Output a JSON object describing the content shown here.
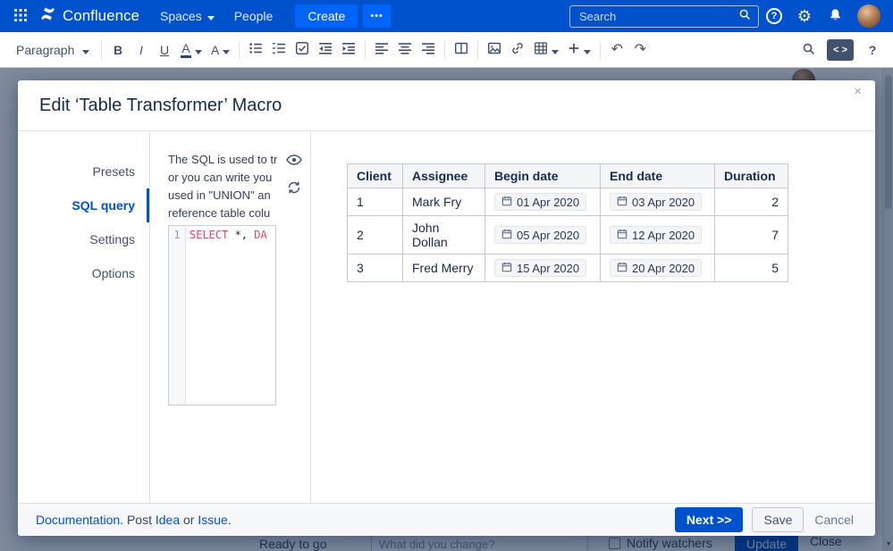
{
  "colors": {
    "nav_background": "#0052CC",
    "create_button": "#0065FF",
    "primary_accent": "#0052CC",
    "sql_keyword": "#DD4A68",
    "table_header_bg": "#F4F5F7"
  },
  "icons": {
    "help": "?",
    "gear": "⚙",
    "close": "×",
    "scroll_down": "▼"
  },
  "nav": {
    "brand": "Confluence",
    "spaces": "Spaces",
    "people": "People",
    "create": "Create",
    "more": "•••",
    "search_placeholder": "Search"
  },
  "toolbar": {
    "block_style": "Paragraph",
    "bold": "B",
    "italic": "I",
    "underline": "U",
    "color_letter": "A",
    "styles_letter": "A",
    "undo": "↶",
    "redo": "↷",
    "source": "< >",
    "help": "?"
  },
  "modal": {
    "title": "Edit ‘Table Transformer’ Macro",
    "tabs": [
      {
        "label": "Presets",
        "selected": false
      },
      {
        "label": "SQL query",
        "selected": true
      },
      {
        "label": "Settings",
        "selected": false
      },
      {
        "label": "Options",
        "selected": false
      }
    ],
    "description_lines": [
      "The SQL is used to tr",
      "or you can write you",
      "used in \"UNION\" an",
      "reference table colu"
    ],
    "editor": {
      "line": "1",
      "kw1": "SELECT",
      "plain": " *, ",
      "kw2": "DA"
    },
    "preview": {
      "headers": [
        "Client",
        "Assignee",
        "Begin date",
        "End date",
        "Duration"
      ],
      "rows": [
        [
          "1",
          "Mark Fry",
          "01 Apr 2020",
          "03 Apr 2020",
          "2"
        ],
        [
          "2",
          "John Dollan",
          "05 Apr 2020",
          "12 Apr 2020",
          "7"
        ],
        [
          "3",
          "Fred Merry",
          "15 Apr 2020",
          "20 Apr 2020",
          "5"
        ]
      ]
    },
    "footer": {
      "documentation": "Documentation",
      "sep1": ". Post ",
      "idea": "Idea",
      "sep2": " or ",
      "issue": "Issue",
      "sep3": ".",
      "next": "Next >>",
      "save": "Save",
      "cancel": "Cancel"
    }
  },
  "page_footer": {
    "status": "Ready to go",
    "change_placeholder": "What did you change?",
    "notify": "Notify watchers",
    "update": "Update",
    "close": "Close"
  }
}
